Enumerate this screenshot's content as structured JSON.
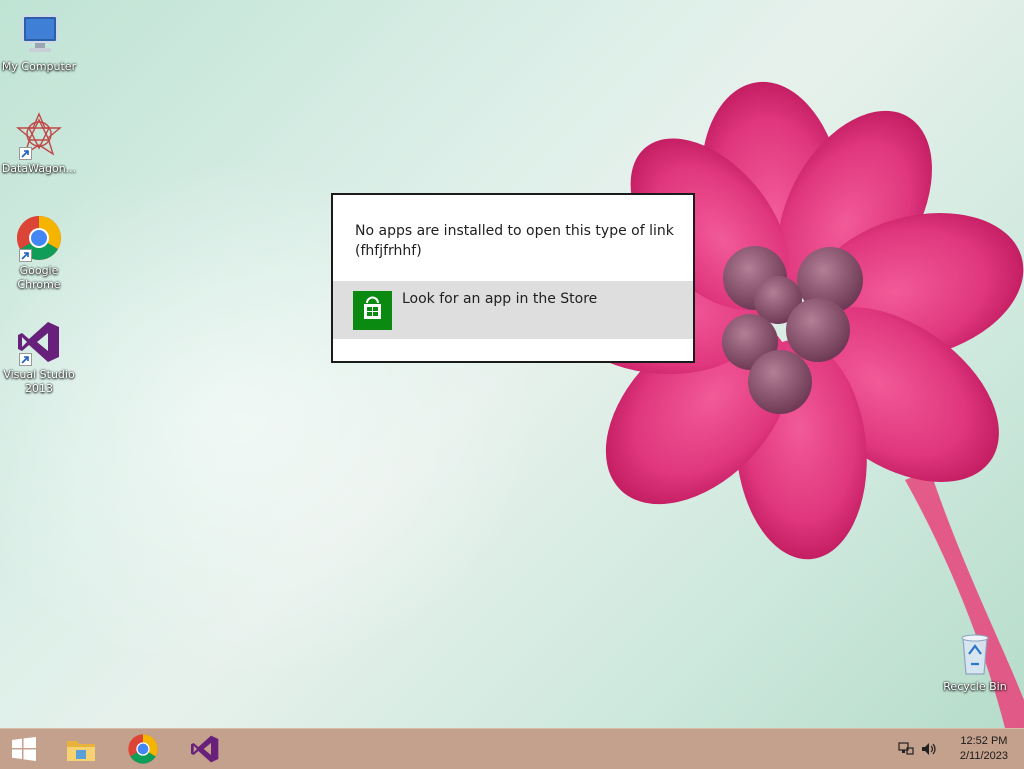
{
  "desktop_icons": [
    {
      "label": "My Computer",
      "icon": "my-computer-icon"
    },
    {
      "label": "DataWagon...",
      "icon": "datawagon-icon"
    },
    {
      "label": "Google Chrome",
      "icon": "chrome-icon"
    },
    {
      "label": "Visual Studio 2013",
      "icon": "visual-studio-icon"
    },
    {
      "label": "Recycle Bin",
      "icon": "recycle-bin-icon"
    }
  ],
  "dialog": {
    "message": "No apps are installed to open this type of link (fhfjfrhhf)",
    "option_label": "Look for an app in the Store",
    "option_icon": "store-icon"
  },
  "taskbar": {
    "items": [
      "start-icon",
      "file-explorer-icon",
      "chrome-icon",
      "visual-studio-icon"
    ],
    "tray": [
      "network-icon",
      "volume-icon"
    ],
    "time": "12:52 PM",
    "date": "2/11/2023"
  },
  "colors": {
    "taskbar": "#c4a18c",
    "store_tile": "#0b8a12",
    "petal": "#e0377e"
  }
}
